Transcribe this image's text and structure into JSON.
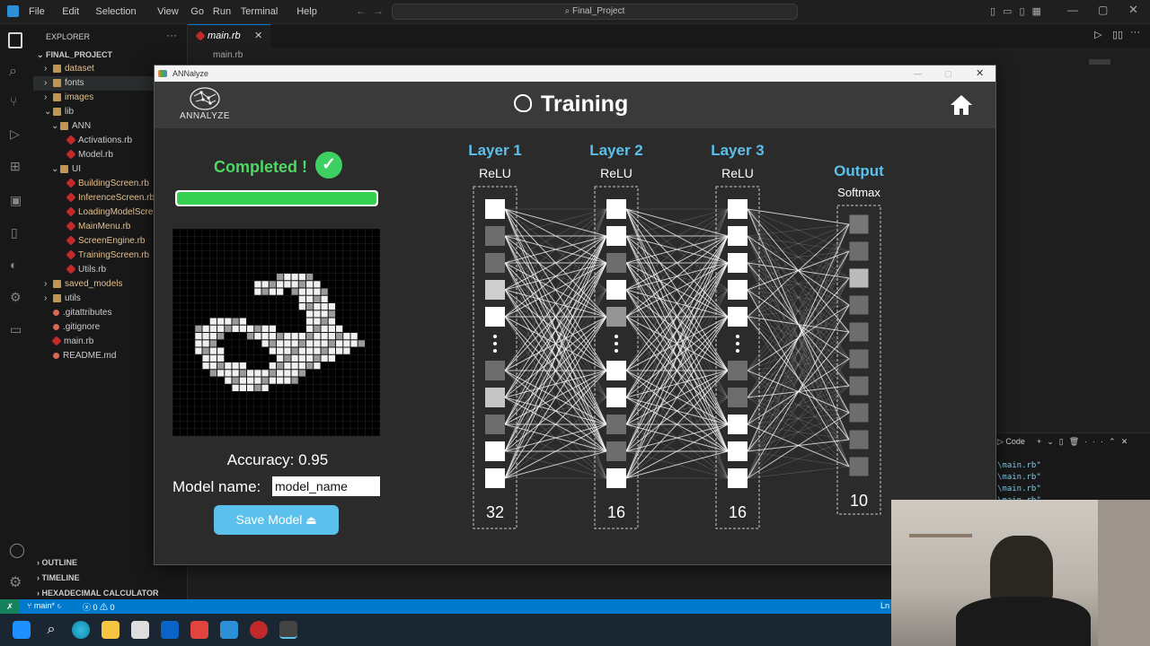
{
  "vscode": {
    "menu": [
      "File",
      "Edit",
      "Selection",
      "View",
      "Go",
      "Run",
      "Terminal",
      "Help"
    ],
    "search": "Final_Project",
    "explorer_title": "EXPLORER",
    "project": "FINAL_PROJECT",
    "tree": [
      {
        "label": "dataset",
        "kind": "folder",
        "indent": 1
      },
      {
        "label": "fonts",
        "kind": "folder",
        "indent": 1,
        "selected": true
      },
      {
        "label": "images",
        "kind": "folder",
        "indent": 1
      },
      {
        "label": "lib",
        "kind": "folder",
        "indent": 1,
        "open": true
      },
      {
        "label": "ANN",
        "kind": "folder",
        "indent": 2,
        "open": true
      },
      {
        "label": "Activations.rb",
        "kind": "ruby",
        "indent": 3
      },
      {
        "label": "Model.rb",
        "kind": "ruby",
        "indent": 3
      },
      {
        "label": "UI",
        "kind": "folder",
        "indent": 2,
        "open": true
      },
      {
        "label": "BuildingScreen.rb",
        "kind": "ruby",
        "indent": 3
      },
      {
        "label": "InferenceScreen.rb",
        "kind": "ruby",
        "indent": 3
      },
      {
        "label": "LoadingModelScre",
        "kind": "ruby",
        "indent": 3
      },
      {
        "label": "MainMenu.rb",
        "kind": "ruby",
        "indent": 3
      },
      {
        "label": "ScreenEngine.rb",
        "kind": "ruby",
        "indent": 3
      },
      {
        "label": "TrainingScreen.rb",
        "kind": "ruby",
        "indent": 3
      },
      {
        "label": "Utils.rb",
        "kind": "ruby",
        "indent": 3
      },
      {
        "label": "saved_models",
        "kind": "folder",
        "indent": 1
      },
      {
        "label": "utils",
        "kind": "folder",
        "indent": 1
      },
      {
        "label": ".gitattributes",
        "kind": "file",
        "indent": 1
      },
      {
        "label": ".gitignore",
        "kind": "file",
        "indent": 1
      },
      {
        "label": "main.rb",
        "kind": "ruby",
        "indent": 1
      },
      {
        "label": "README.md",
        "kind": "file",
        "indent": 1
      }
    ],
    "outline": "OUTLINE",
    "timeline": "TIMELINE",
    "hexcalc": "HEXADECIMAL CALCULATOR",
    "tab": "main.rb",
    "breadcrumb": "main.rb",
    "terminal_title": "Code",
    "terminal_lines": [
      "\\main.rb\"",
      "\\main.rb\"",
      "\\main.rb\"",
      "\\main.rb\""
    ],
    "status_branch": "main*",
    "status_problems": "0 ⚠ 0",
    "status_right": "Ln"
  },
  "app": {
    "window_title": "ANNalyze",
    "logo_text": "ANNALYZE",
    "screen_title": "Training",
    "status_text": "Completed !",
    "progress": 1.0,
    "accuracy_label": "Accuracy: 0.95",
    "model_name_label": "Model name:",
    "model_name_value": "model_name",
    "save_label": "Save Model",
    "layers": [
      {
        "title": "Layer 1",
        "activation": "ReLU",
        "size": "32",
        "nodes": [
          1.0,
          0.25,
          0.25,
          0.75,
          1.0,
          0.25,
          0.7,
          0.25,
          1.0,
          1.0
        ]
      },
      {
        "title": "Layer 2",
        "activation": "ReLU",
        "size": "16",
        "nodes": [
          1.0,
          1.0,
          0.25,
          1.0,
          0.45,
          1.0,
          1.0,
          0.25,
          0.25,
          1.0
        ]
      },
      {
        "title": "Layer 3",
        "activation": "ReLU",
        "size": "16",
        "nodes": [
          1.0,
          1.0,
          1.0,
          1.0,
          1.0,
          0.25,
          0.25,
          1.0,
          1.0,
          1.0
        ]
      },
      {
        "title": "Output",
        "activation": "Softmax",
        "size": "10",
        "nodes": [
          0.3,
          0.25,
          0.65,
          0.25,
          0.25,
          0.25,
          0.25,
          0.25,
          0.25,
          0.25
        ]
      }
    ],
    "digit_pixels": [
      "............................",
      "............................",
      "............................",
      "............................",
      "............................",
      "............................",
      "..............ooooo.........",
      "...........ooooooooo........",
      "...........oooo.ooooo.......",
      ".................oooo.......",
      ".................ooooo......",
      "..................oooo......",
      ".....ooooo........oooo......",
      "...ooooooooooo....ooooo.....",
      "...oooo...ooooooooooooooo...",
      "...ooo......oooooooooooooo..",
      "...oooo......ooooooooooo....",
      "....ooo.......oooooooo......",
      "....oooooo...ooooooo........",
      ".....ooooooooooooo..........",
      ".......oooooooooo...........",
      "........ooooo...............",
      "............................",
      "............................",
      "............................",
      "............................",
      "............................",
      "............................"
    ]
  }
}
